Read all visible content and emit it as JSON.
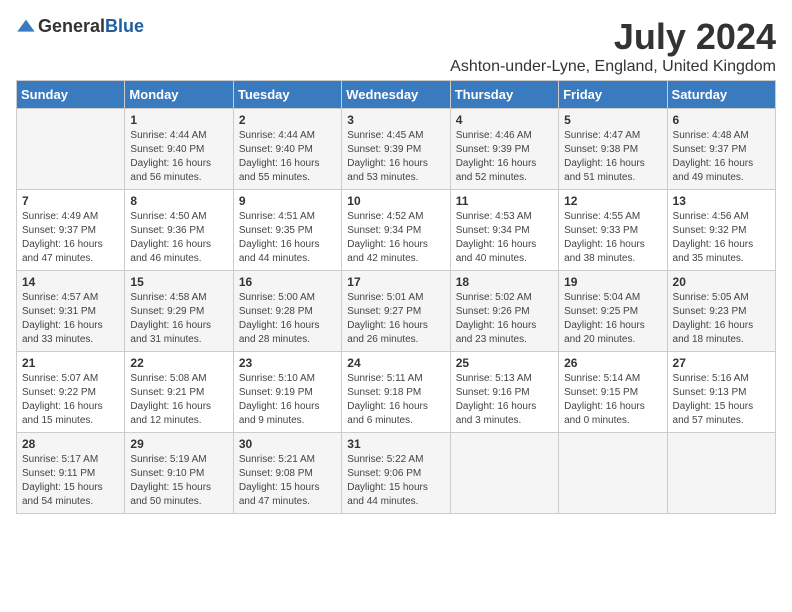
{
  "header": {
    "logo_general": "General",
    "logo_blue": "Blue",
    "month_title": "July 2024",
    "location": "Ashton-under-Lyne, England, United Kingdom"
  },
  "days_of_week": [
    "Sunday",
    "Monday",
    "Tuesday",
    "Wednesday",
    "Thursday",
    "Friday",
    "Saturday"
  ],
  "weeks": [
    [
      {
        "day": "",
        "info": ""
      },
      {
        "day": "1",
        "info": "Sunrise: 4:44 AM\nSunset: 9:40 PM\nDaylight: 16 hours and 56 minutes."
      },
      {
        "day": "2",
        "info": "Sunrise: 4:44 AM\nSunset: 9:40 PM\nDaylight: 16 hours and 55 minutes."
      },
      {
        "day": "3",
        "info": "Sunrise: 4:45 AM\nSunset: 9:39 PM\nDaylight: 16 hours and 53 minutes."
      },
      {
        "day": "4",
        "info": "Sunrise: 4:46 AM\nSunset: 9:39 PM\nDaylight: 16 hours and 52 minutes."
      },
      {
        "day": "5",
        "info": "Sunrise: 4:47 AM\nSunset: 9:38 PM\nDaylight: 16 hours and 51 minutes."
      },
      {
        "day": "6",
        "info": "Sunrise: 4:48 AM\nSunset: 9:37 PM\nDaylight: 16 hours and 49 minutes."
      }
    ],
    [
      {
        "day": "7",
        "info": "Sunrise: 4:49 AM\nSunset: 9:37 PM\nDaylight: 16 hours and 47 minutes."
      },
      {
        "day": "8",
        "info": "Sunrise: 4:50 AM\nSunset: 9:36 PM\nDaylight: 16 hours and 46 minutes."
      },
      {
        "day": "9",
        "info": "Sunrise: 4:51 AM\nSunset: 9:35 PM\nDaylight: 16 hours and 44 minutes."
      },
      {
        "day": "10",
        "info": "Sunrise: 4:52 AM\nSunset: 9:34 PM\nDaylight: 16 hours and 42 minutes."
      },
      {
        "day": "11",
        "info": "Sunrise: 4:53 AM\nSunset: 9:34 PM\nDaylight: 16 hours and 40 minutes."
      },
      {
        "day": "12",
        "info": "Sunrise: 4:55 AM\nSunset: 9:33 PM\nDaylight: 16 hours and 38 minutes."
      },
      {
        "day": "13",
        "info": "Sunrise: 4:56 AM\nSunset: 9:32 PM\nDaylight: 16 hours and 35 minutes."
      }
    ],
    [
      {
        "day": "14",
        "info": "Sunrise: 4:57 AM\nSunset: 9:31 PM\nDaylight: 16 hours and 33 minutes."
      },
      {
        "day": "15",
        "info": "Sunrise: 4:58 AM\nSunset: 9:29 PM\nDaylight: 16 hours and 31 minutes."
      },
      {
        "day": "16",
        "info": "Sunrise: 5:00 AM\nSunset: 9:28 PM\nDaylight: 16 hours and 28 minutes."
      },
      {
        "day": "17",
        "info": "Sunrise: 5:01 AM\nSunset: 9:27 PM\nDaylight: 16 hours and 26 minutes."
      },
      {
        "day": "18",
        "info": "Sunrise: 5:02 AM\nSunset: 9:26 PM\nDaylight: 16 hours and 23 minutes."
      },
      {
        "day": "19",
        "info": "Sunrise: 5:04 AM\nSunset: 9:25 PM\nDaylight: 16 hours and 20 minutes."
      },
      {
        "day": "20",
        "info": "Sunrise: 5:05 AM\nSunset: 9:23 PM\nDaylight: 16 hours and 18 minutes."
      }
    ],
    [
      {
        "day": "21",
        "info": "Sunrise: 5:07 AM\nSunset: 9:22 PM\nDaylight: 16 hours and 15 minutes."
      },
      {
        "day": "22",
        "info": "Sunrise: 5:08 AM\nSunset: 9:21 PM\nDaylight: 16 hours and 12 minutes."
      },
      {
        "day": "23",
        "info": "Sunrise: 5:10 AM\nSunset: 9:19 PM\nDaylight: 16 hours and 9 minutes."
      },
      {
        "day": "24",
        "info": "Sunrise: 5:11 AM\nSunset: 9:18 PM\nDaylight: 16 hours and 6 minutes."
      },
      {
        "day": "25",
        "info": "Sunrise: 5:13 AM\nSunset: 9:16 PM\nDaylight: 16 hours and 3 minutes."
      },
      {
        "day": "26",
        "info": "Sunrise: 5:14 AM\nSunset: 9:15 PM\nDaylight: 16 hours and 0 minutes."
      },
      {
        "day": "27",
        "info": "Sunrise: 5:16 AM\nSunset: 9:13 PM\nDaylight: 15 hours and 57 minutes."
      }
    ],
    [
      {
        "day": "28",
        "info": "Sunrise: 5:17 AM\nSunset: 9:11 PM\nDaylight: 15 hours and 54 minutes."
      },
      {
        "day": "29",
        "info": "Sunrise: 5:19 AM\nSunset: 9:10 PM\nDaylight: 15 hours and 50 minutes."
      },
      {
        "day": "30",
        "info": "Sunrise: 5:21 AM\nSunset: 9:08 PM\nDaylight: 15 hours and 47 minutes."
      },
      {
        "day": "31",
        "info": "Sunrise: 5:22 AM\nSunset: 9:06 PM\nDaylight: 15 hours and 44 minutes."
      },
      {
        "day": "",
        "info": ""
      },
      {
        "day": "",
        "info": ""
      },
      {
        "day": "",
        "info": ""
      }
    ]
  ]
}
